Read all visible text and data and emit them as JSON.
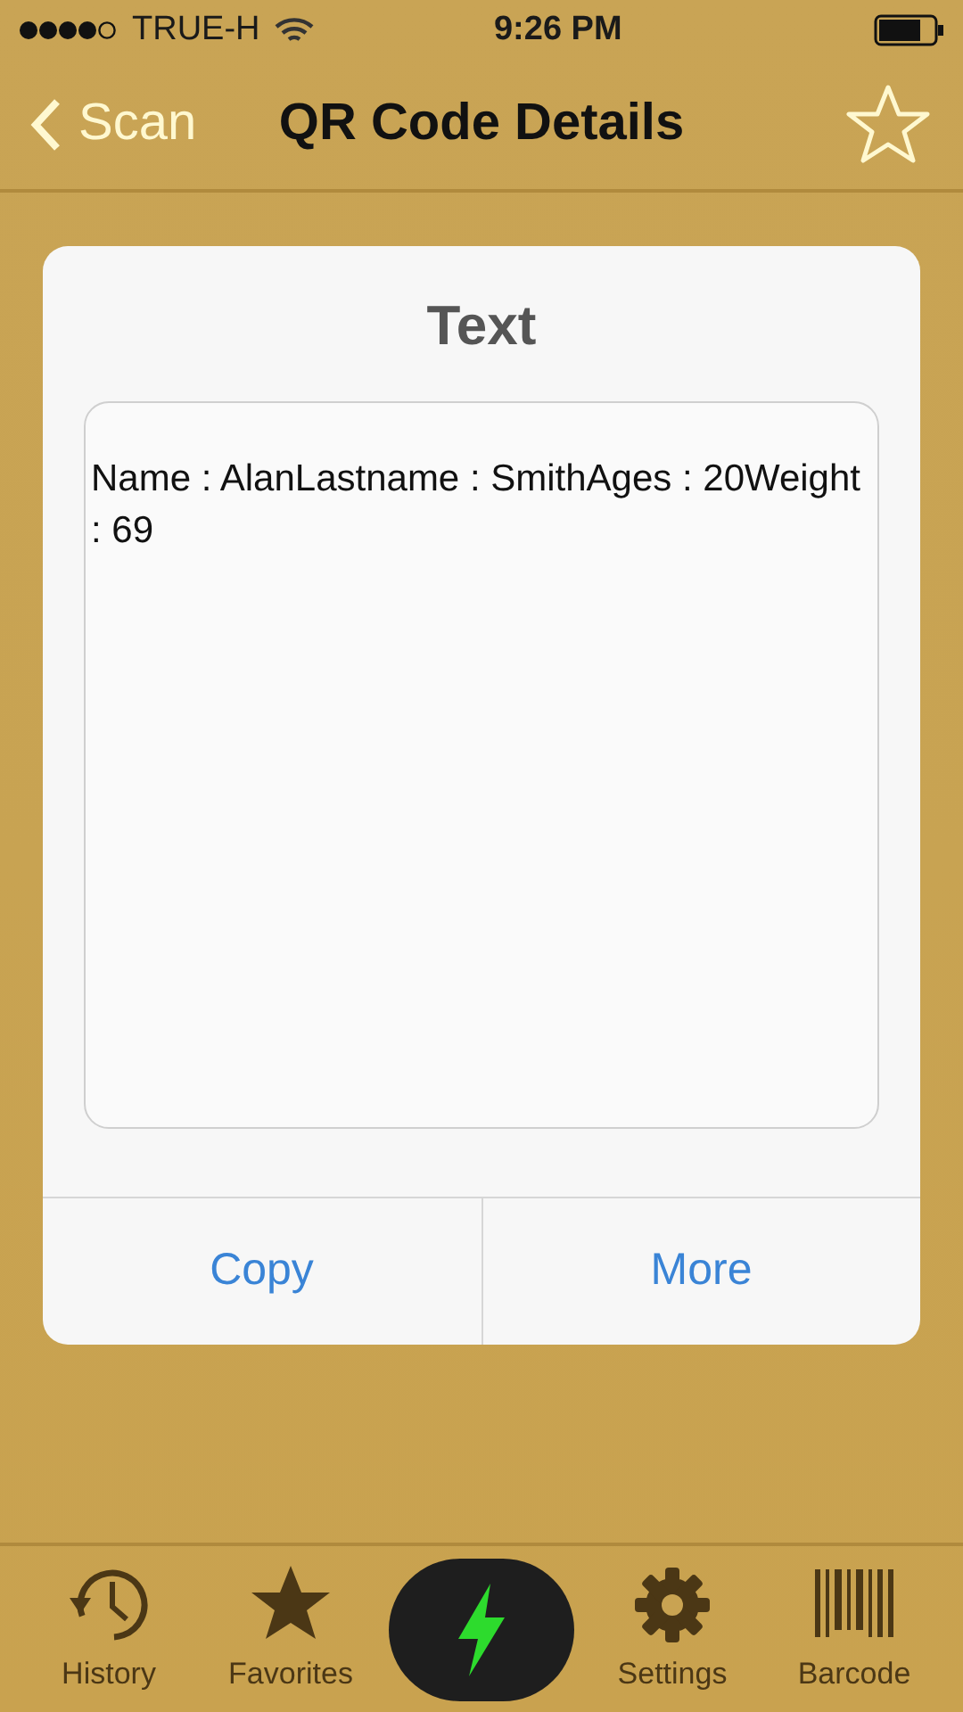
{
  "status_bar": {
    "carrier": "TRUE-H",
    "time": "9:26 PM"
  },
  "nav": {
    "back": "Scan",
    "title": "QR Code Details"
  },
  "card": {
    "title": "Text",
    "content": "Name : AlanLastname : SmithAges : 20Weight : 69",
    "buttons": [
      "Copy",
      "More"
    ]
  },
  "tab_bar": [
    {
      "kind": "history",
      "label": "History"
    },
    {
      "kind": "favorites",
      "label": "Favorites"
    },
    {
      "kind": "scan"
    },
    {
      "kind": "settings",
      "label": "Settings"
    },
    {
      "kind": "barcode",
      "label": "Barcode"
    }
  ]
}
